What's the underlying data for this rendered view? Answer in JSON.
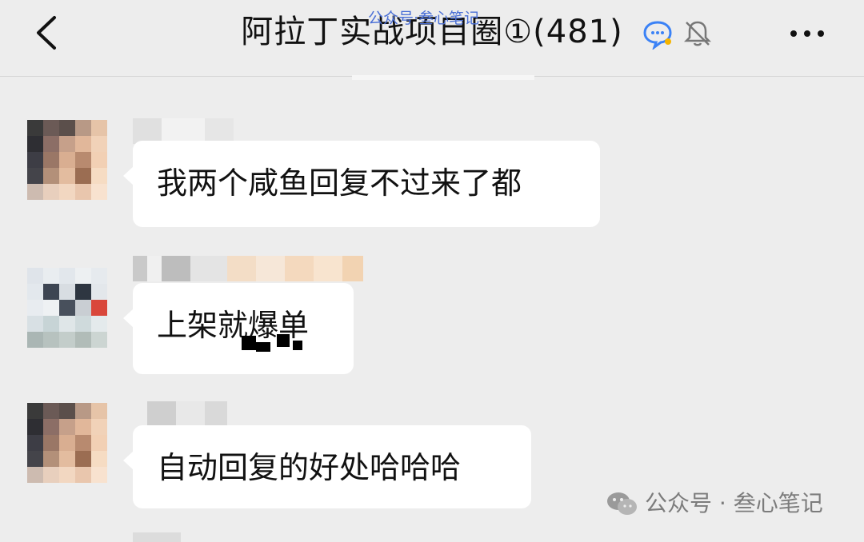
{
  "header": {
    "title": "阿拉丁实战项目圈①(481)",
    "watermark_top": "公众号·叁心笔记",
    "back_icon": "chevron-left-icon",
    "chat_icon": "chat-bubble-icon",
    "mute_icon": "bell-off-icon",
    "more_icon": "more-dots-icon"
  },
  "messages": [
    {
      "text": "我两个咸鱼回复不过来了都"
    },
    {
      "text": "上架就爆单"
    },
    {
      "text": "自动回复的好处哈哈哈"
    }
  ],
  "watermark": {
    "text": "公众号 · 叁心笔记"
  },
  "colors": {
    "background": "#ededed",
    "bubble": "#ffffff",
    "accent": "#4a6fd6"
  }
}
